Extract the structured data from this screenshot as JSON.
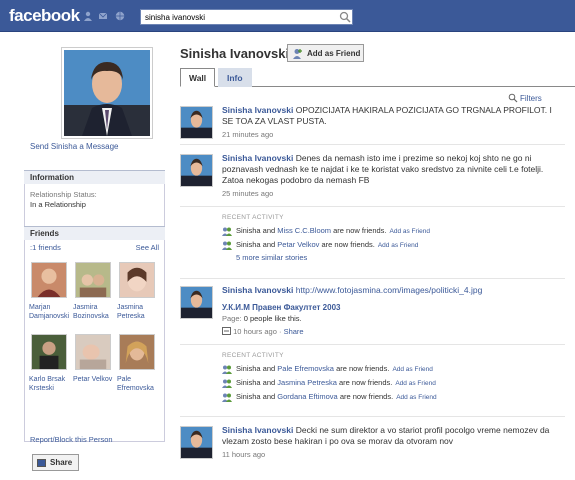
{
  "topbar": {
    "logo": "facebook",
    "search_value": "sinisha ivanovski"
  },
  "left": {
    "send_message": "Send Sinisha a Message",
    "information_header": "Information",
    "relationship_label": "Relationship Status:",
    "relationship_value": "In a Relationship",
    "friends_header": "Friends",
    "friends_count": ":1 friends",
    "see_all": "See All",
    "friends": [
      {
        "name": "Marjan Damjanovski"
      },
      {
        "name": "Jasmira Bozinovska"
      },
      {
        "name": "Jasmina Petreska"
      },
      {
        "name": "Karlo Brsak Krsteski"
      },
      {
        "name": "Petar Velkov"
      },
      {
        "name": "Pale Efremovska"
      }
    ],
    "report": "Report/Block this Person",
    "share": "Share"
  },
  "header": {
    "name": "Sinisha Ivanovski",
    "add_friend": "Add as Friend",
    "tab_wall": "Wall",
    "tab_info": "Info",
    "filters": "Filters"
  },
  "posts": [
    {
      "author": "Sinisha Ivanovski",
      "text": " OPOZICIJATA HAKIRALA POZICIJATA GO TRGNALA PROFILOT. I SE TOA ZA VLAST PUSTA.",
      "time": "21 minutes ago"
    },
    {
      "author": "Sinisha Ivanovski",
      "text": " Denes da nemash isto ime i prezime so nekoj koj shto ne go ni poznavash vednash ke te najdat i ke te koristat vako sredstvo za nivnite celi t.e fotelji. Zatoa nekogas podobro da nemash FB",
      "time": "25 minutes ago"
    },
    {
      "author": "Sinisha Ivanovski",
      "text": " http://www.fotojasmina.com/images/politicki_4.jpg",
      "link_title": "У.К.И.М Правен Факултет 2003",
      "link_page": "Page: ",
      "link_likes": "0 people like this.",
      "time": "10 hours ago",
      "share": "Share"
    },
    {
      "author": "Sinisha Ivanovski",
      "text": " Decki ne sum direktor a vo stariot profil pocolgo vreme nemozev da vlezam zosto bese hakiran i po ova se morav da otvoram nov",
      "time": "11 hours ago"
    }
  ],
  "recent_activity_1": {
    "header": "RECENT ACTIVITY",
    "rows": [
      {
        "pre": "Sinisha and ",
        "who": "Miss C.C.Bloom",
        "post": " are now friends.",
        "add": "Add as Friend"
      },
      {
        "pre": "Sinisha and ",
        "who": "Petar Velkov",
        "post": " are now friends.",
        "add": "Add as Friend"
      }
    ],
    "more": "5 more similar stories"
  },
  "recent_activity_2": {
    "header": "RECENT ACTIVITY",
    "rows": [
      {
        "pre": "Sinisha and ",
        "who": "Pale Efremovska",
        "post": " are now friends.",
        "add": "Add as Friend"
      },
      {
        "pre": "Sinisha and ",
        "who": "Jasmina Petreska",
        "post": " are now friends.",
        "add": "Add as Friend"
      },
      {
        "pre": "Sinisha and ",
        "who": "Gordana Eftimova",
        "post": " are now friends.",
        "add": "Add as Friend"
      }
    ]
  },
  "colors": {
    "brand": "#3b5998",
    "tab_bg": "#d8dfea"
  }
}
